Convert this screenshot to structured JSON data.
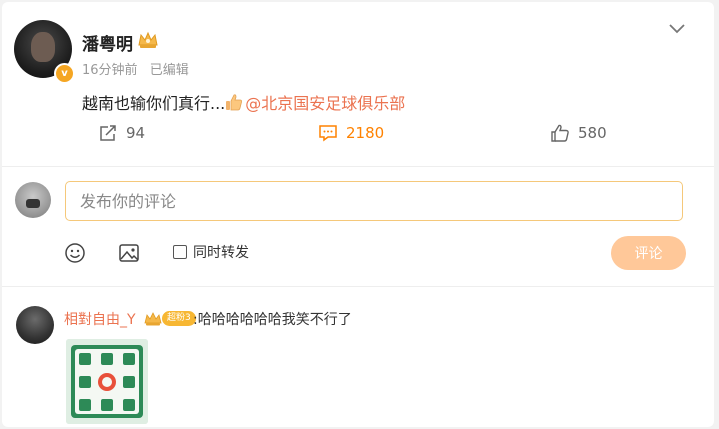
{
  "post": {
    "author": "潘粤明",
    "verified_mark": "v",
    "time": "16分钟前",
    "edited": "已编辑",
    "text": "越南也输你们真行...",
    "mention": "@北京国安足球俱乐部"
  },
  "actions": {
    "repost_count": "94",
    "comment_count": "2180",
    "like_count": "580"
  },
  "composer": {
    "placeholder": "发布你的评论",
    "sync_label": "同时转发",
    "submit_label": "评论"
  },
  "comments": [
    {
      "user": "相對自由_Y",
      "badge": "超粉3",
      "text": ":哈哈哈哈哈哈我笑不行了"
    }
  ],
  "colors": {
    "accent": "#ff8200",
    "mention": "#eb7350",
    "submit_bg": "#ffc899",
    "input_border": "#f5c87a"
  },
  "icons": [
    "crown-icon",
    "chevron-down-icon",
    "thumbs-up-emoji-icon",
    "repost-icon",
    "comment-icon",
    "like-icon",
    "emoji-icon",
    "image-icon"
  ]
}
